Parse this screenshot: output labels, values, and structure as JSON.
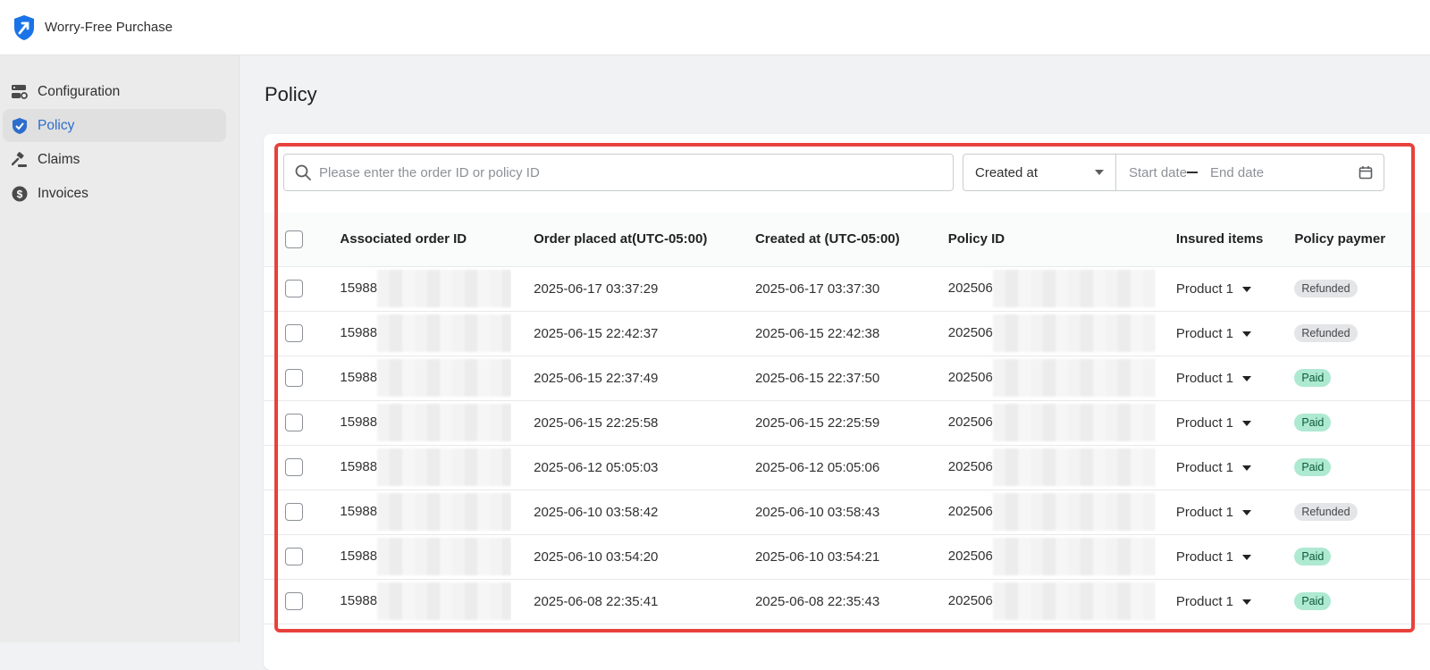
{
  "app": {
    "title": "Worry-Free Purchase",
    "logo_icon": "shield-arrow-logo",
    "accent": "#2c6ecb"
  },
  "sidebar": {
    "items": [
      {
        "label": "Configuration",
        "icon": "settings-icon",
        "active": false
      },
      {
        "label": "Policy",
        "icon": "shield-check-icon",
        "active": true
      },
      {
        "label": "Claims",
        "icon": "gavel-icon",
        "active": false
      },
      {
        "label": "Invoices",
        "icon": "dollar-icon",
        "active": false
      }
    ]
  },
  "page": {
    "title": "Policy"
  },
  "filters": {
    "search_placeholder": "Please enter the order ID or policy ID",
    "date_field_selected": "Created at",
    "start_date_placeholder": "Start date",
    "end_date_placeholder": "End date"
  },
  "table": {
    "columns": [
      "Associated order ID",
      "Order placed at(UTC-05:00)",
      "Created at (UTC-05:00)",
      "Policy ID",
      "Insured items",
      "Policy paymer"
    ],
    "rows": [
      {
        "order_id": "15988",
        "order_placed": "2025-06-17 03:37:29",
        "created": "2025-06-17 03:37:30",
        "policy_id": "202506",
        "insured": "Product 1",
        "payment": "Refunded"
      },
      {
        "order_id": "15988",
        "order_placed": "2025-06-15 22:42:37",
        "created": "2025-06-15 22:42:38",
        "policy_id": "202506",
        "insured": "Product 1",
        "payment": "Refunded"
      },
      {
        "order_id": "15988",
        "order_placed": "2025-06-15 22:37:49",
        "created": "2025-06-15 22:37:50",
        "policy_id": "202506",
        "insured": "Product 1",
        "payment": "Paid"
      },
      {
        "order_id": "15988",
        "order_placed": "2025-06-15 22:25:58",
        "created": "2025-06-15 22:25:59",
        "policy_id": "202506",
        "insured": "Product 1",
        "payment": "Paid"
      },
      {
        "order_id": "15988",
        "order_placed": "2025-06-12 05:05:03",
        "created": "2025-06-12 05:05:06",
        "policy_id": "202506",
        "insured": "Product 1",
        "payment": "Paid"
      },
      {
        "order_id": "15988",
        "order_placed": "2025-06-10 03:58:42",
        "created": "2025-06-10 03:58:43",
        "policy_id": "202506",
        "insured": "Product 1",
        "payment": "Refunded"
      },
      {
        "order_id": "15988",
        "order_placed": "2025-06-10 03:54:20",
        "created": "2025-06-10 03:54:21",
        "policy_id": "202506",
        "insured": "Product 1",
        "payment": "Paid"
      },
      {
        "order_id": "15988",
        "order_placed": "2025-06-08 22:35:41",
        "created": "2025-06-08 22:35:43",
        "policy_id": "202506",
        "insured": "Product 1",
        "payment": "Paid"
      }
    ]
  },
  "colors": {
    "highlight_border": "#e8413c",
    "paid_badge": "#aee9d1",
    "refunded_badge": "#e4e5e7"
  }
}
